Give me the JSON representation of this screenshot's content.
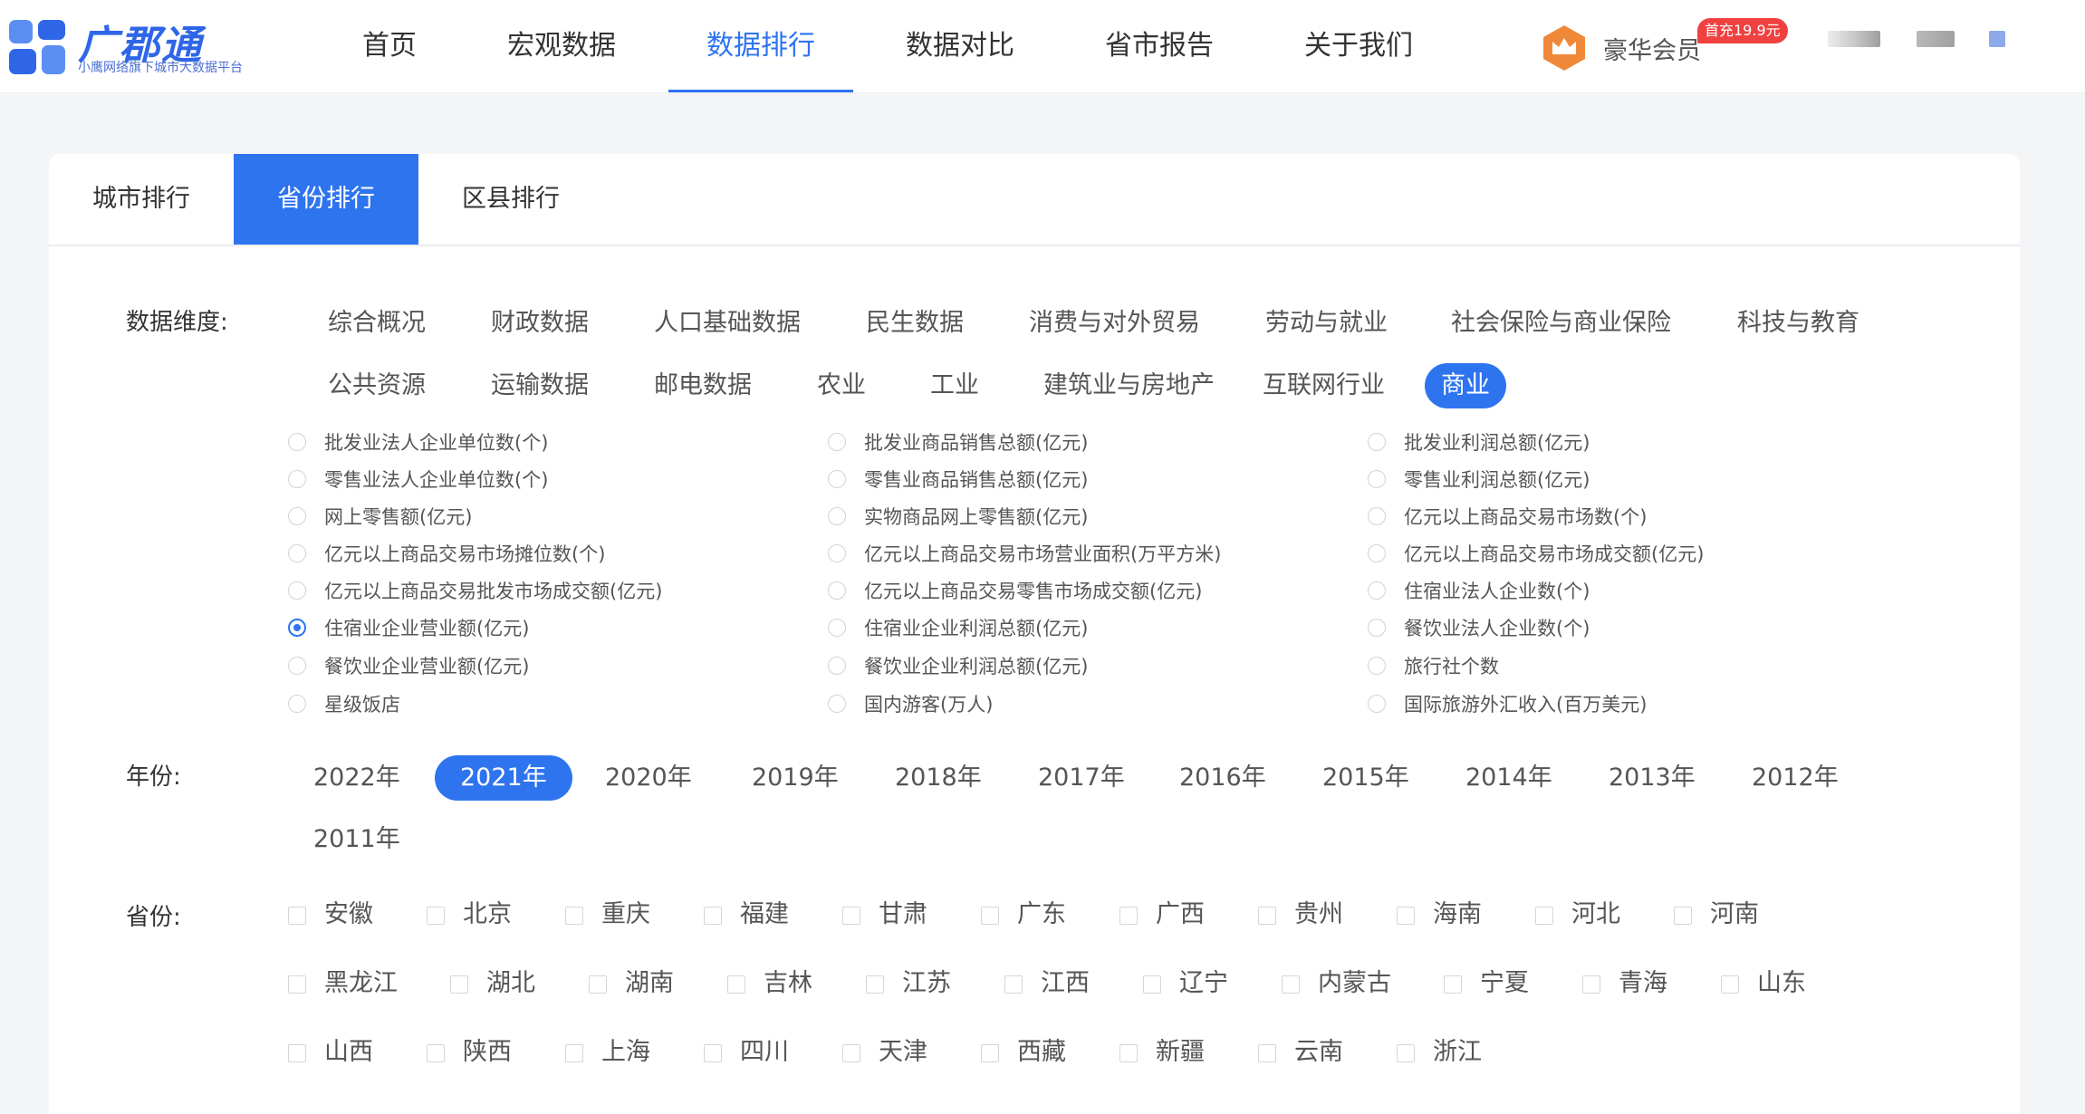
{
  "header": {
    "logo_name": "广郡通",
    "logo_sub": "小鹰网络旗下城市大数据平台",
    "nav": [
      {
        "label": "首页",
        "active": false
      },
      {
        "label": "宏观数据",
        "active": false
      },
      {
        "label": "数据排行",
        "active": true
      },
      {
        "label": "数据对比",
        "active": false
      },
      {
        "label": "省市报告",
        "active": false
      },
      {
        "label": "关于我们",
        "active": false
      }
    ],
    "vip_label": "豪华会员",
    "vip_badge": "首充19.9元"
  },
  "tabs": [
    {
      "label": "城市排行",
      "active": false
    },
    {
      "label": "省份排行",
      "active": true
    },
    {
      "label": "区县排行",
      "active": false
    }
  ],
  "labels": {
    "dimension": "数据维度:",
    "year": "年份:",
    "province": "省份:"
  },
  "dimensions": [
    {
      "label": "综合概况",
      "active": false
    },
    {
      "label": "财政数据",
      "active": false
    },
    {
      "label": "人口基础数据",
      "active": false
    },
    {
      "label": "民生数据",
      "active": false
    },
    {
      "label": "消费与对外贸易",
      "active": false
    },
    {
      "label": "劳动与就业",
      "active": false
    },
    {
      "label": "社会保险与商业保险",
      "active": false
    },
    {
      "label": "科技与教育",
      "active": false
    },
    {
      "label": "公共资源",
      "active": false
    },
    {
      "label": "运输数据",
      "active": false
    },
    {
      "label": "邮电数据",
      "active": false
    },
    {
      "label": "农业",
      "active": false
    },
    {
      "label": "工业",
      "active": false
    },
    {
      "label": "建筑业与房地产",
      "active": false
    },
    {
      "label": "互联网行业",
      "active": false
    },
    {
      "label": "商业",
      "active": true
    }
  ],
  "metrics": [
    {
      "label": "批发业法人企业单位数(个)",
      "checked": false
    },
    {
      "label": "批发业商品销售总额(亿元)",
      "checked": false
    },
    {
      "label": "批发业利润总额(亿元)",
      "checked": false
    },
    {
      "label": "零售业法人企业单位数(个)",
      "checked": false
    },
    {
      "label": "零售业商品销售总额(亿元)",
      "checked": false
    },
    {
      "label": "零售业利润总额(亿元)",
      "checked": false
    },
    {
      "label": "网上零售额(亿元)",
      "checked": false
    },
    {
      "label": "实物商品网上零售额(亿元)",
      "checked": false
    },
    {
      "label": "亿元以上商品交易市场数(个)",
      "checked": false
    },
    {
      "label": "亿元以上商品交易市场摊位数(个)",
      "checked": false
    },
    {
      "label": "亿元以上商品交易市场营业面积(万平方米)",
      "checked": false
    },
    {
      "label": "亿元以上商品交易市场成交额(亿元)",
      "checked": false
    },
    {
      "label": "亿元以上商品交易批发市场成交额(亿元)",
      "checked": false
    },
    {
      "label": "亿元以上商品交易零售市场成交额(亿元)",
      "checked": false
    },
    {
      "label": "住宿业法人企业数(个)",
      "checked": false
    },
    {
      "label": "住宿业企业营业额(亿元)",
      "checked": true
    },
    {
      "label": "住宿业企业利润总额(亿元)",
      "checked": false
    },
    {
      "label": "餐饮业法人企业数(个)",
      "checked": false
    },
    {
      "label": "餐饮业企业营业额(亿元)",
      "checked": false
    },
    {
      "label": "餐饮业企业利润总额(亿元)",
      "checked": false
    },
    {
      "label": "旅行社个数",
      "checked": false
    },
    {
      "label": "星级饭店",
      "checked": false
    },
    {
      "label": "国内游客(万人)",
      "checked": false
    },
    {
      "label": "国际旅游外汇收入(百万美元)",
      "checked": false
    }
  ],
  "years": [
    {
      "label": "2022年",
      "active": false
    },
    {
      "label": "2021年",
      "active": true
    },
    {
      "label": "2020年",
      "active": false
    },
    {
      "label": "2019年",
      "active": false
    },
    {
      "label": "2018年",
      "active": false
    },
    {
      "label": "2017年",
      "active": false
    },
    {
      "label": "2016年",
      "active": false
    },
    {
      "label": "2015年",
      "active": false
    },
    {
      "label": "2014年",
      "active": false
    },
    {
      "label": "2013年",
      "active": false
    },
    {
      "label": "2012年",
      "active": false
    },
    {
      "label": "2011年",
      "active": false
    }
  ],
  "provinces": [
    "安徽",
    "北京",
    "重庆",
    "福建",
    "甘肃",
    "广东",
    "广西",
    "贵州",
    "海南",
    "河北",
    "河南",
    "黑龙江",
    "湖北",
    "湖南",
    "吉林",
    "江苏",
    "江西",
    "辽宁",
    "内蒙古",
    "宁夏",
    "青海",
    "山东",
    "山西",
    "陕西",
    "上海",
    "四川",
    "天津",
    "西藏",
    "新疆",
    "云南",
    "浙江"
  ],
  "colors": {
    "accent": "#2f74ef",
    "vip_orange": "#f0883a",
    "badge_red": "#f04141"
  }
}
